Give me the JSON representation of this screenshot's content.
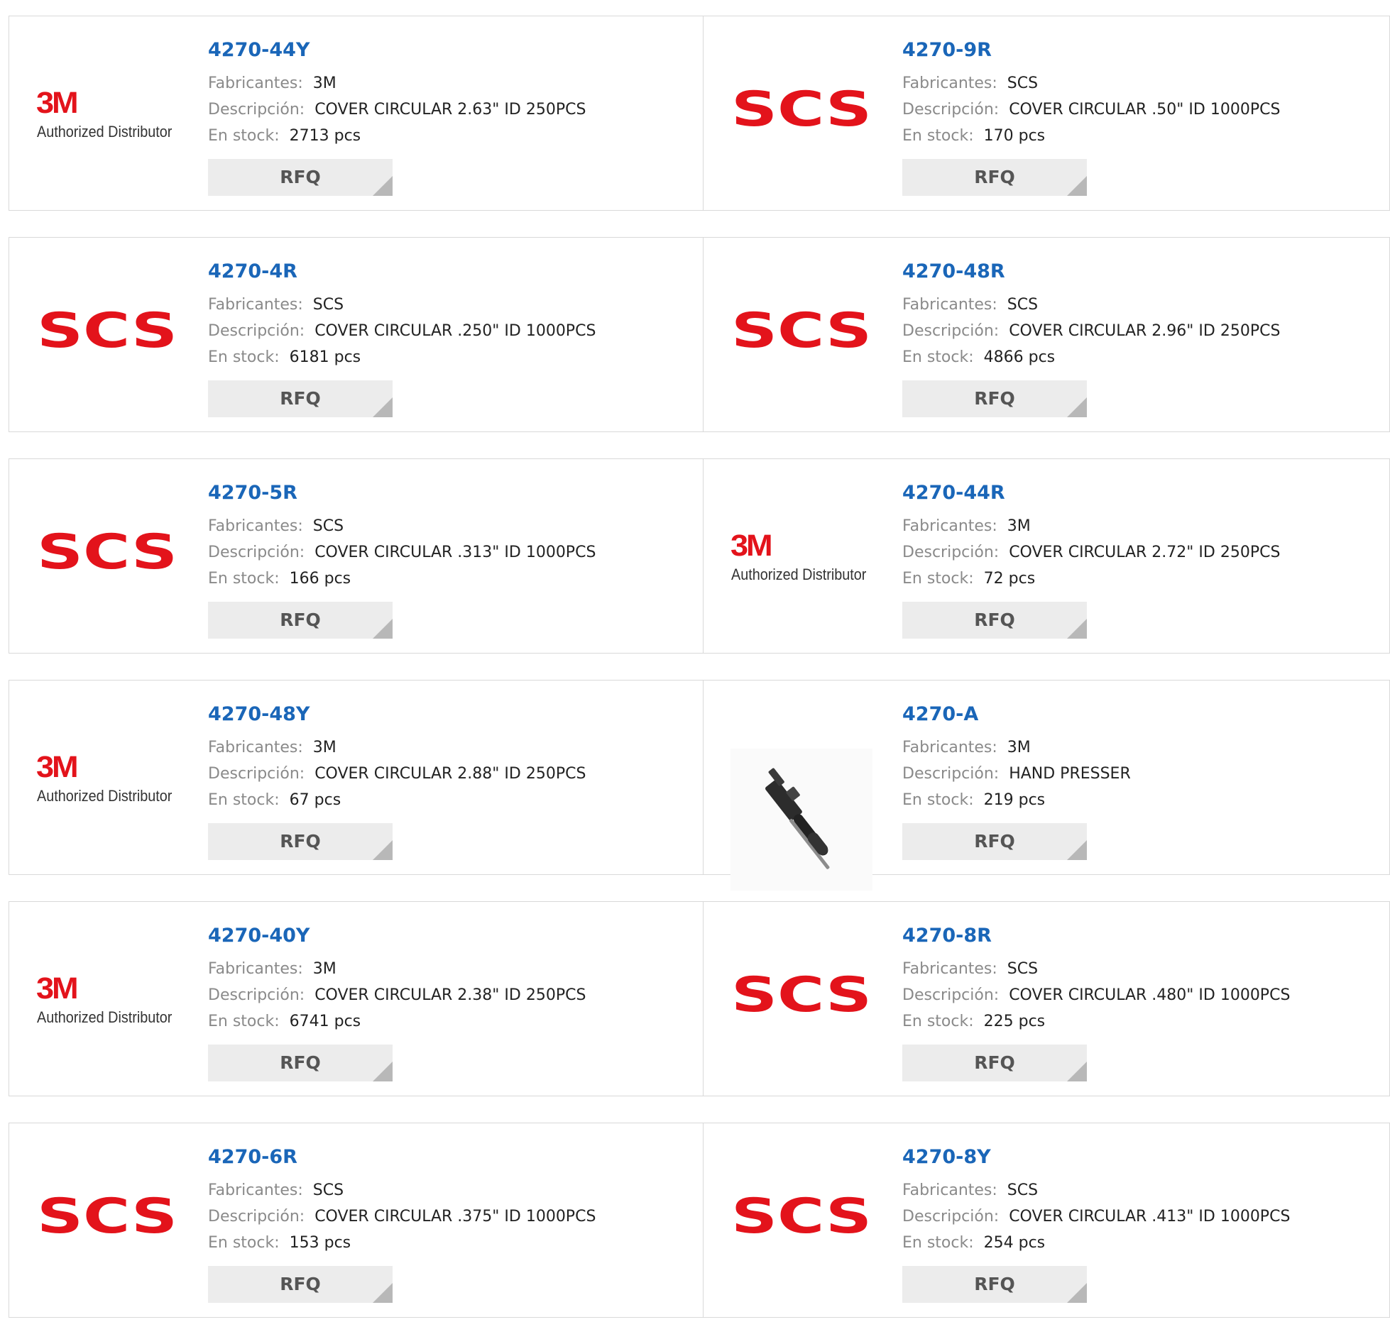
{
  "labels": {
    "manufacturer": "Fabricantes:",
    "description": "Descripción:",
    "stock": "En stock:",
    "rfq": "RFQ"
  },
  "logos": {
    "three_m_mark": "3M",
    "three_m_tagline": "Authorized Distributor",
    "scs_mark": "SCS"
  },
  "colors": {
    "part_link": "#1a66b8",
    "brand_red": "#e3131b",
    "rfq_bg": "#ececec"
  },
  "products": [
    {
      "part": "4270-44Y",
      "manufacturer": "3M",
      "description": "COVER CIRCULAR 2.63\" ID 250PCS",
      "stock": "2713 pcs",
      "logo": "3m"
    },
    {
      "part": "4270-9R",
      "manufacturer": "SCS",
      "description": "COVER CIRCULAR .50\" ID 1000PCS",
      "stock": "170 pcs",
      "logo": "scs"
    },
    {
      "part": "4270-4R",
      "manufacturer": "SCS",
      "description": "COVER CIRCULAR .250\" ID 1000PCS",
      "stock": "6181 pcs",
      "logo": "scs"
    },
    {
      "part": "4270-48R",
      "manufacturer": "SCS",
      "description": "COVER CIRCULAR 2.96\" ID 250PCS",
      "stock": "4866 pcs",
      "logo": "scs"
    },
    {
      "part": "4270-5R",
      "manufacturer": "SCS",
      "description": "COVER CIRCULAR .313\" ID 1000PCS",
      "stock": "166 pcs",
      "logo": "scs"
    },
    {
      "part": "4270-44R",
      "manufacturer": "3M",
      "description": "COVER CIRCULAR 2.72\" ID 250PCS",
      "stock": "72 pcs",
      "logo": "3m"
    },
    {
      "part": "4270-48Y",
      "manufacturer": "3M",
      "description": "COVER CIRCULAR 2.88\" ID 250PCS",
      "stock": "67 pcs",
      "logo": "3m"
    },
    {
      "part": "4270-A",
      "manufacturer": "3M",
      "description": "HAND PRESSER",
      "stock": "219 pcs",
      "logo": "tool"
    },
    {
      "part": "4270-40Y",
      "manufacturer": "3M",
      "description": "COVER CIRCULAR 2.38\" ID 250PCS",
      "stock": "6741 pcs",
      "logo": "3m"
    },
    {
      "part": "4270-8R",
      "manufacturer": "SCS",
      "description": "COVER CIRCULAR .480\" ID 1000PCS",
      "stock": "225 pcs",
      "logo": "scs"
    },
    {
      "part": "4270-6R",
      "manufacturer": "SCS",
      "description": "COVER CIRCULAR .375\" ID 1000PCS",
      "stock": "153 pcs",
      "logo": "scs"
    },
    {
      "part": "4270-8Y",
      "manufacturer": "SCS",
      "description": "COVER CIRCULAR .413\" ID 1000PCS",
      "stock": "254 pcs",
      "logo": "scs"
    }
  ]
}
